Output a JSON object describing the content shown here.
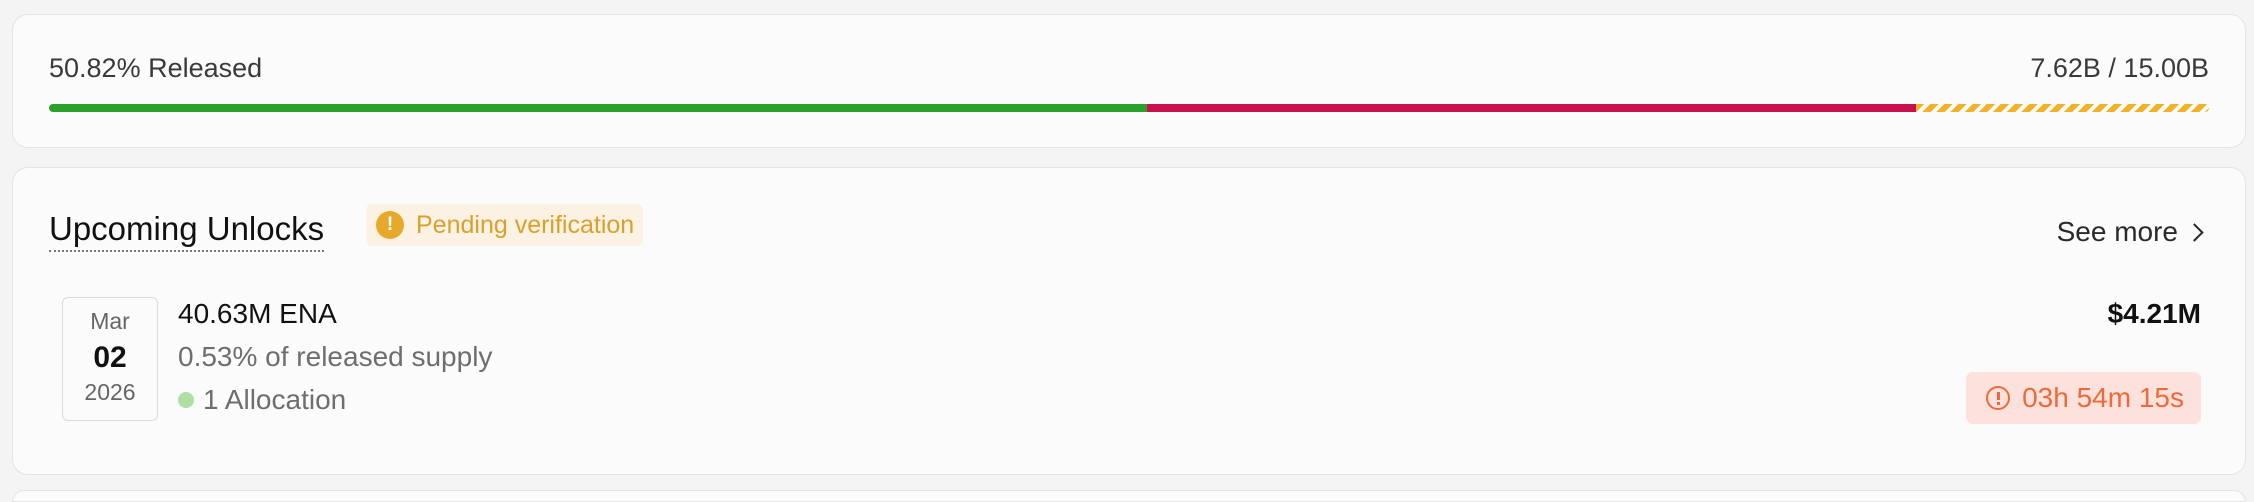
{
  "release": {
    "label": "50.82% Released",
    "total": "7.62B / 15.00B",
    "progress": [
      {
        "name": "released",
        "fraction": 0.5082,
        "color": "#2aa12a"
      },
      {
        "name": "allocated",
        "fraction": 0.356,
        "color": "#c8104c"
      },
      {
        "name": "remaining",
        "fraction": 0.1358,
        "color": "#f2b228"
      }
    ]
  },
  "upcoming": {
    "title": "Upcoming Unlocks",
    "badge": {
      "icon": "warning-circle-icon",
      "text": "Pending verification",
      "color": "#d8a12c"
    },
    "see_more": "See more",
    "unlock": {
      "date": {
        "month": "Mar",
        "day": "02",
        "year": "2026"
      },
      "amount": "40.63M ENA",
      "pct_supply": "0.53% of released supply",
      "allocation": "1 Allocation",
      "allocation_color": "#aee0a6",
      "value": "$4.21M",
      "countdown": "03h 54m 15s",
      "countdown_color": "#ef6a3a"
    }
  }
}
